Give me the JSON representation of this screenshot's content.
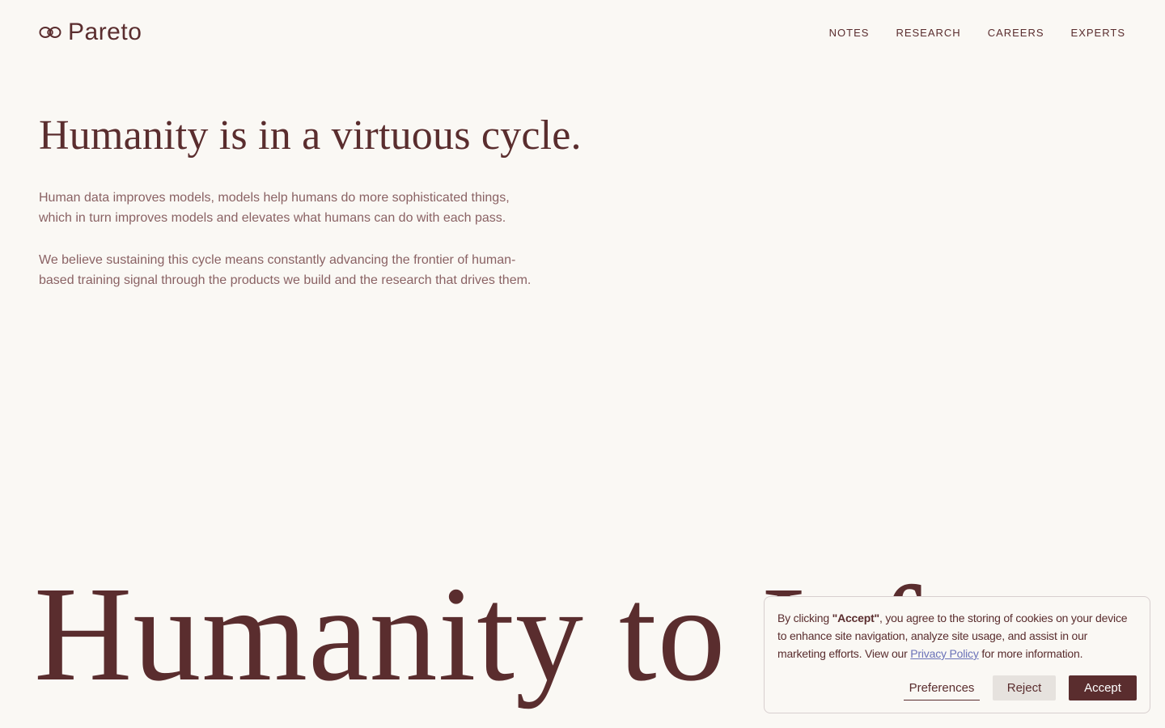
{
  "header": {
    "brand": "Pareto",
    "nav": [
      "NOTES",
      "RESEARCH",
      "CAREERS",
      "EXPERTS"
    ]
  },
  "hero": {
    "title": "Humanity is in a virtuous cycle.",
    "paragraph_1": "Human data improves models, models help humans do more sophisticated things, which in turn improves models and elevates what humans can do with each pass.",
    "paragraph_2": "We believe sustaining this cycle means constantly advancing the frontier of human-based training signal through the products we build and the research that drives them."
  },
  "display": {
    "text": "Humanity to Inf"
  },
  "cookie": {
    "text_before": "By clicking ",
    "text_bold": "\"Accept\"",
    "text_middle": ", you agree to the storing of cookies on your device to enhance site navigation, analyze site usage, and assist in our marketing efforts. View our ",
    "link": "Privacy Policy",
    "text_after": " for more information.",
    "preferences": "Preferences",
    "reject": "Reject",
    "accept": "Accept"
  },
  "colors": {
    "background": "#faf8f4",
    "primary": "#5a2d2e",
    "muted_text": "#8a6264",
    "link": "#6b72b8",
    "reject_bg": "#e6e2de"
  }
}
